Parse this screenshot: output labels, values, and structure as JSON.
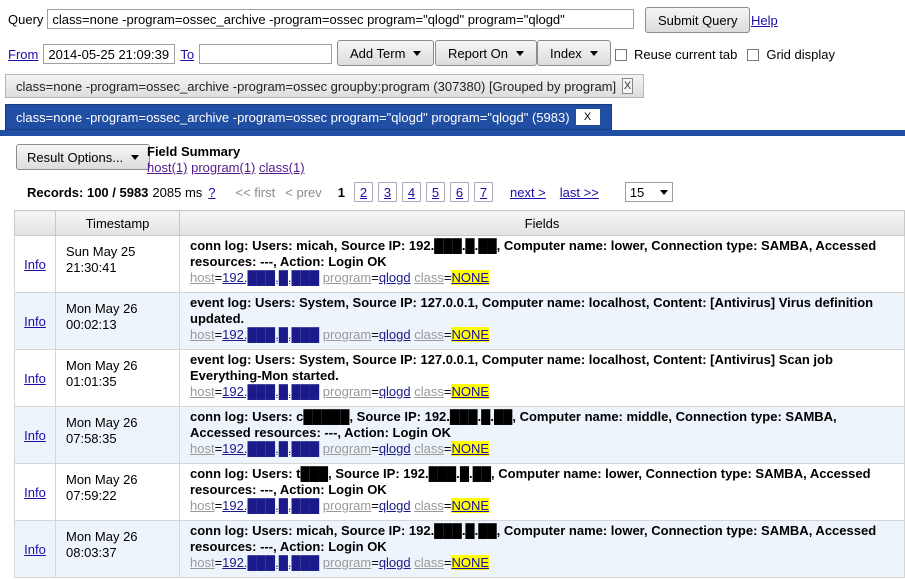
{
  "query": {
    "label": "Query",
    "value": "class=none -program=ossec_archive -program=ossec program=\"qlogd\" program=\"qlogd\"",
    "submit_label": "Submit Query",
    "help_label": "Help"
  },
  "range": {
    "from_label": "From",
    "from_value": "2014-05-25 21:09:39",
    "to_label": "To",
    "to_value": ""
  },
  "toolbar": {
    "add_term": "Add Term",
    "report_on": "Report On",
    "index": "Index",
    "reuse_tab": "Reuse current tab",
    "grid_display": "Grid display"
  },
  "tabs": [
    {
      "label": "class=none -program=ossec_archive -program=ossec groupby:program (307380) [Grouped by program]",
      "close": "X"
    },
    {
      "label": "class=none -program=ossec_archive -program=ossec program=\"qlogd\" program=\"qlogd\" (5983)",
      "close": "X"
    }
  ],
  "results": {
    "options_label": "Result Options...",
    "field_summary_title": "Field Summary",
    "field_links": [
      "host(1)",
      "program(1)",
      "class(1)"
    ],
    "records_label": "Records: 100 / 5983",
    "timing": "2085 ms",
    "timing_help": "?",
    "first": "<< first",
    "prev": "< prev",
    "current_page": "1",
    "pages": [
      "2",
      "3",
      "4",
      "5",
      "6",
      "7"
    ],
    "next": "next >",
    "last": "last >>",
    "per_page": "15"
  },
  "table": {
    "columns": [
      "",
      "Timestamp",
      "Fields"
    ],
    "info_label": "Info",
    "rows": [
      {
        "ts1": "Sun May 25",
        "ts2": "21:30:41",
        "msg": "conn log: Users: micah, Source IP: 192.███.█.██, Computer name: lower, Connection type: SAMBA, Accessed resources: ---, Action: Login OK",
        "host": "192.███.█.███",
        "program": "qlogd",
        "class": "NONE"
      },
      {
        "ts1": "Mon May 26",
        "ts2": "00:02:13",
        "msg": "event log: Users: System, Source IP: 127.0.0.1, Computer name: localhost, Content: [Antivirus] Virus definition updated.",
        "host": "192.███.█.███",
        "program": "qlogd",
        "class": "NONE"
      },
      {
        "ts1": "Mon May 26",
        "ts2": "01:01:35",
        "msg": "event log: Users: System, Source IP: 127.0.0.1, Computer name: localhost, Content: [Antivirus] Scan job Everything-Mon started.",
        "host": "192.███.█.███",
        "program": "qlogd",
        "class": "NONE"
      },
      {
        "ts1": "Mon May 26",
        "ts2": "07:58:35",
        "msg": "conn log: Users: c█████, Source IP: 192.███.█.██, Computer name: middle, Connection type: SAMBA, Accessed resources: ---, Action: Login OK",
        "host": "192.███.█.███",
        "program": "qlogd",
        "class": "NONE"
      },
      {
        "ts1": "Mon May 26",
        "ts2": "07:59:22",
        "msg": "conn log: Users: t███, Source IP: 192.███.█.██, Computer name: lower, Connection type: SAMBA, Accessed resources: ---, Action: Login OK",
        "host": "192.███.█.███",
        "program": "qlogd",
        "class": "NONE"
      },
      {
        "ts1": "Mon May 26",
        "ts2": "08:03:37",
        "msg": "conn log: Users: micah, Source IP: 192.███.█.██, Computer name: lower, Connection type: SAMBA, Accessed resources: ---, Action: Login OK",
        "host": "192.███.█.███",
        "program": "qlogd",
        "class": "NONE"
      }
    ]
  }
}
